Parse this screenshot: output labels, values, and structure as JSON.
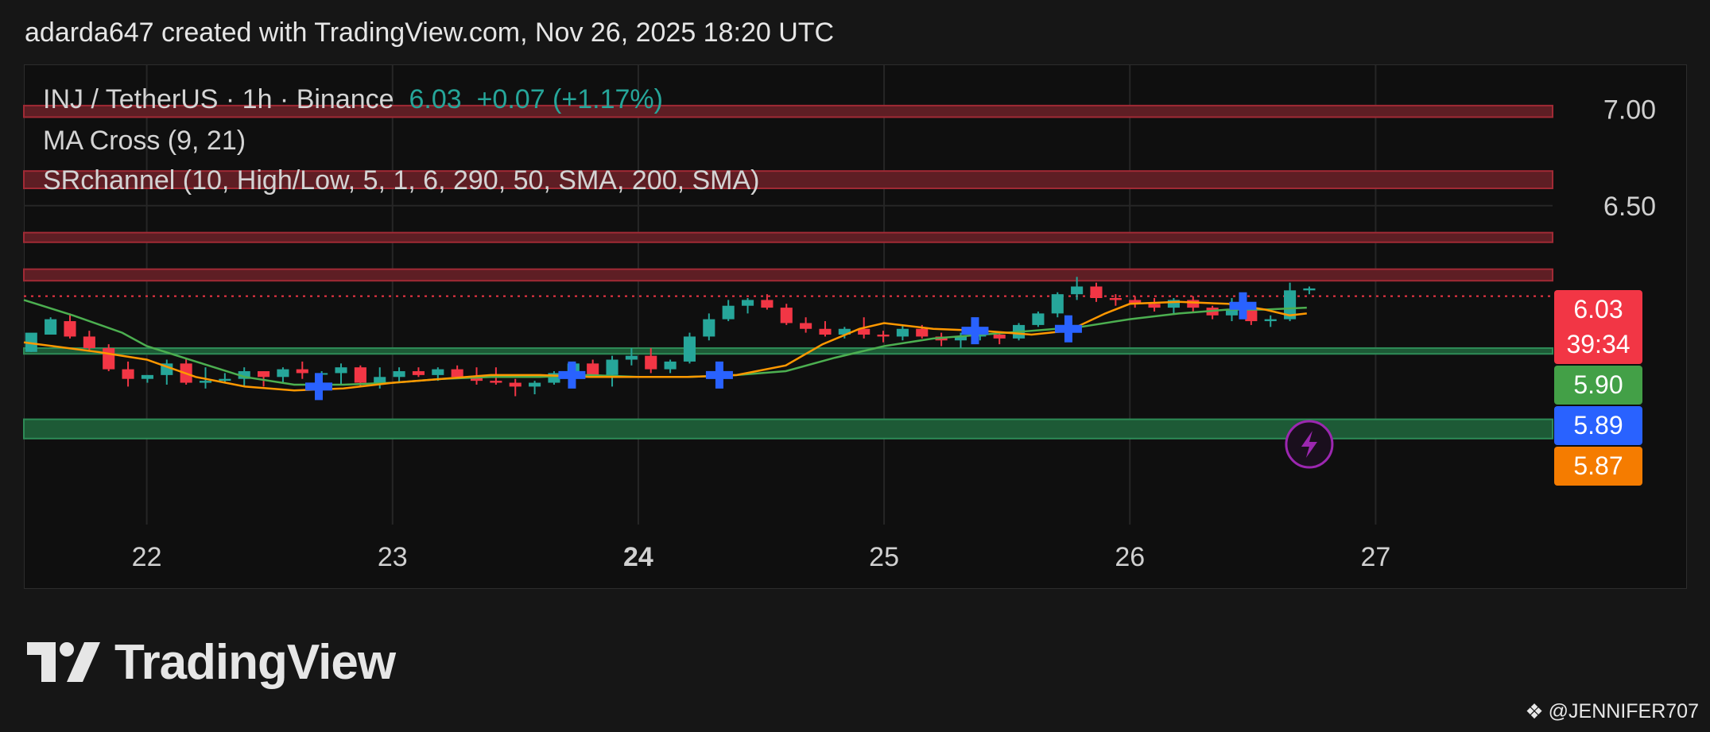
{
  "header": {
    "attribution": "adarda647 created with TradingView.com, Nov 26, 2025 18:20 UTC"
  },
  "legend": {
    "symbol": "INJ / TetherUS · 1h · Binance",
    "price": "6.03",
    "change": "+0.07 (+1.17%)",
    "indicator_1": "MA Cross (9, 21)",
    "indicator_2": "SRchannel (10, High/Low, 5, 1, 6, 290, 50, SMA, 200, SMA)"
  },
  "branding": {
    "name": "TradingView",
    "logo_icon": "tradingview-logo-icon"
  },
  "watermark": {
    "text": "@JENNIFER707",
    "icon": "diamond-icon"
  },
  "colors": {
    "up": "#26a69a",
    "down": "#f23645",
    "ma_fast": "#ff9800",
    "ma_slow": "#4caf50",
    "resistance_zone": "#5e1e24",
    "support_zone": "#1d5a36",
    "cross_marker": "#2962ff",
    "price_label": "#f23645",
    "label_590": "#43a047",
    "label_589": "#2962ff",
    "label_587": "#f57c00",
    "alert_icon": "#9c27b0"
  },
  "chart_data": {
    "type": "candlestick",
    "symbol": "INJ / TetherUS",
    "interval": "1h",
    "exchange": "Binance",
    "ylim": [
      5.0,
      7.23
    ],
    "x_range_days": [
      21.5,
      27.72
    ],
    "y_ticks": [
      "7.00",
      "6.50"
    ],
    "x_ticks": [
      {
        "label": "22",
        "day": 22,
        "bold": false
      },
      {
        "label": "23",
        "day": 23,
        "bold": false
      },
      {
        "label": "24",
        "day": 24,
        "bold": true
      },
      {
        "label": "25",
        "day": 25,
        "bold": false
      },
      {
        "label": "26",
        "day": 26,
        "bold": false
      },
      {
        "label": "27",
        "day": 27,
        "bold": false
      }
    ],
    "price_labels": [
      {
        "value": 6.03,
        "text": "6.03",
        "sub": "39:34",
        "color": "#f23645"
      },
      {
        "value": 5.9,
        "text": "5.90",
        "color": "#43a047"
      },
      {
        "value": 5.89,
        "text": "5.89",
        "color": "#2962ff"
      },
      {
        "value": 5.87,
        "text": "5.87",
        "color": "#f57c00"
      }
    ],
    "current_price": 6.03,
    "resistance_zones": [
      [
        6.96,
        7.02
      ],
      [
        6.59,
        6.68
      ],
      [
        6.31,
        6.36
      ],
      [
        6.11,
        6.17
      ]
    ],
    "support_zones": [
      [
        5.73,
        5.76
      ],
      [
        5.29,
        5.39
      ]
    ],
    "ma_fast": {
      "name": "MA 9",
      "color": "#ff9800",
      "points": [
        [
          21.5,
          5.79
        ],
        [
          21.8,
          5.74
        ],
        [
          22.0,
          5.7
        ],
        [
          22.2,
          5.61
        ],
        [
          22.4,
          5.56
        ],
        [
          22.6,
          5.54
        ],
        [
          22.8,
          5.55
        ],
        [
          23.0,
          5.58
        ],
        [
          23.2,
          5.6
        ],
        [
          23.4,
          5.62
        ],
        [
          23.6,
          5.62
        ],
        [
          23.8,
          5.61
        ],
        [
          24.0,
          5.61
        ],
        [
          24.2,
          5.61
        ],
        [
          24.4,
          5.62
        ],
        [
          24.6,
          5.67
        ],
        [
          24.75,
          5.78
        ],
        [
          24.9,
          5.86
        ],
        [
          25.0,
          5.89
        ],
        [
          25.2,
          5.86
        ],
        [
          25.4,
          5.85
        ],
        [
          25.6,
          5.83
        ],
        [
          25.75,
          5.85
        ],
        [
          25.9,
          5.94
        ],
        [
          26.0,
          5.99
        ],
        [
          26.2,
          6.0
        ],
        [
          26.4,
          5.99
        ],
        [
          26.55,
          5.96
        ],
        [
          26.65,
          5.93
        ],
        [
          26.72,
          5.94
        ]
      ]
    },
    "ma_slow": {
      "name": "MA 21",
      "color": "#4caf50",
      "points": [
        [
          21.5,
          6.01
        ],
        [
          21.7,
          5.93
        ],
        [
          21.9,
          5.84
        ],
        [
          22.0,
          5.77
        ],
        [
          22.2,
          5.69
        ],
        [
          22.4,
          5.61
        ],
        [
          22.6,
          5.57
        ],
        [
          22.8,
          5.57
        ],
        [
          23.0,
          5.58
        ],
        [
          23.2,
          5.6
        ],
        [
          23.4,
          5.61
        ],
        [
          23.6,
          5.61
        ],
        [
          23.8,
          5.62
        ],
        [
          24.0,
          5.61
        ],
        [
          24.2,
          5.61
        ],
        [
          24.4,
          5.62
        ],
        [
          24.6,
          5.64
        ],
        [
          24.8,
          5.71
        ],
        [
          25.0,
          5.77
        ],
        [
          25.2,
          5.81
        ],
        [
          25.4,
          5.83
        ],
        [
          25.6,
          5.85
        ],
        [
          25.8,
          5.87
        ],
        [
          26.0,
          5.91
        ],
        [
          26.2,
          5.94
        ],
        [
          26.4,
          5.96
        ],
        [
          26.55,
          5.96
        ],
        [
          26.72,
          5.97
        ]
      ]
    },
    "cross_markers": [
      [
        22.7,
        5.56
      ],
      [
        23.73,
        5.62
      ],
      [
        24.33,
        5.62
      ],
      [
        25.37,
        5.85
      ],
      [
        25.75,
        5.86
      ],
      [
        26.46,
        5.98
      ]
    ],
    "alert_icon": {
      "day": 26.73,
      "value": 5.26,
      "icon": "lightning-icon"
    },
    "ohlc": [
      [
        5.74,
        5.83,
        5.74,
        5.84
      ],
      [
        5.83,
        5.92,
        5.9,
        5.91
      ],
      [
        5.9,
        5.94,
        5.81,
        5.82
      ],
      [
        5.82,
        5.85,
        5.75,
        5.76
      ],
      [
        5.76,
        5.78,
        5.64,
        5.65
      ],
      [
        5.65,
        5.69,
        5.56,
        5.6
      ],
      [
        5.6,
        5.62,
        5.58,
        5.62
      ],
      [
        5.62,
        5.7,
        5.57,
        5.68
      ],
      [
        5.68,
        5.71,
        5.57,
        5.58
      ],
      [
        5.58,
        5.66,
        5.55,
        5.59
      ],
      [
        5.59,
        5.63,
        5.58,
        5.6
      ],
      [
        5.6,
        5.66,
        5.56,
        5.64
      ],
      [
        5.64,
        5.64,
        5.56,
        5.61
      ],
      [
        5.61,
        5.66,
        5.58,
        5.65
      ],
      [
        5.65,
        5.69,
        5.6,
        5.63
      ],
      [
        5.63,
        5.64,
        5.6,
        5.63
      ],
      [
        5.63,
        5.68,
        5.57,
        5.66
      ],
      [
        5.66,
        5.67,
        5.56,
        5.58
      ],
      [
        5.58,
        5.66,
        5.55,
        5.61
      ],
      [
        5.61,
        5.66,
        5.58,
        5.64
      ],
      [
        5.64,
        5.66,
        5.61,
        5.62
      ],
      [
        5.62,
        5.66,
        5.59,
        5.65
      ],
      [
        5.65,
        5.67,
        5.6,
        5.61
      ],
      [
        5.61,
        5.66,
        5.57,
        5.59
      ],
      [
        5.59,
        5.66,
        5.57,
        5.58
      ],
      [
        5.58,
        5.6,
        5.51,
        5.56
      ],
      [
        5.56,
        5.59,
        5.52,
        5.58
      ],
      [
        5.58,
        5.64,
        5.57,
        5.63
      ],
      [
        5.63,
        5.69,
        5.61,
        5.68
      ],
      [
        5.68,
        5.7,
        5.61,
        5.62
      ],
      [
        5.62,
        5.72,
        5.56,
        5.7
      ],
      [
        5.7,
        5.76,
        5.67,
        5.72
      ],
      [
        5.72,
        5.76,
        5.63,
        5.65
      ],
      [
        5.65,
        5.7,
        5.63,
        5.69
      ],
      [
        5.69,
        5.84,
        5.68,
        5.82
      ],
      [
        5.82,
        5.94,
        5.8,
        5.91
      ],
      [
        5.91,
        6.01,
        5.9,
        5.98
      ],
      [
        5.98,
        6.02,
        5.94,
        6.01
      ],
      [
        6.01,
        6.04,
        5.96,
        5.97
      ],
      [
        5.97,
        5.99,
        5.88,
        5.89
      ],
      [
        5.89,
        5.92,
        5.84,
        5.86
      ],
      [
        5.86,
        5.9,
        5.82,
        5.83
      ],
      [
        5.83,
        5.87,
        5.81,
        5.86
      ],
      [
        5.86,
        5.92,
        5.81,
        5.83
      ],
      [
        5.83,
        5.85,
        5.79,
        5.82
      ],
      [
        5.82,
        5.88,
        5.8,
        5.86
      ],
      [
        5.86,
        5.88,
        5.81,
        5.82
      ],
      [
        5.82,
        5.84,
        5.77,
        5.8
      ],
      [
        5.8,
        5.84,
        5.76,
        5.82
      ],
      [
        5.82,
        5.85,
        5.8,
        5.83
      ],
      [
        5.83,
        5.84,
        5.78,
        5.81
      ],
      [
        5.81,
        5.89,
        5.8,
        5.88
      ],
      [
        5.88,
        5.95,
        5.87,
        5.94
      ],
      [
        5.94,
        6.05,
        5.92,
        6.04
      ],
      [
        6.04,
        6.13,
        6.01,
        6.08
      ],
      [
        6.08,
        6.1,
        6.0,
        6.02
      ],
      [
        6.02,
        6.04,
        5.98,
        6.01
      ],
      [
        6.01,
        6.03,
        5.97,
        5.99
      ],
      [
        5.99,
        6.02,
        5.95,
        5.97
      ],
      [
        5.97,
        6.02,
        5.94,
        6.01
      ],
      [
        6.01,
        6.03,
        5.95,
        5.97
      ],
      [
        5.97,
        5.98,
        5.91,
        5.93
      ],
      [
        5.93,
        6.02,
        5.9,
        5.96
      ],
      [
        5.96,
        5.97,
        5.88,
        5.9
      ],
      [
        5.9,
        5.93,
        5.87,
        5.91
      ],
      [
        5.91,
        6.1,
        5.9,
        6.06
      ],
      [
        6.06,
        6.08,
        6.04,
        6.07
      ]
    ]
  }
}
